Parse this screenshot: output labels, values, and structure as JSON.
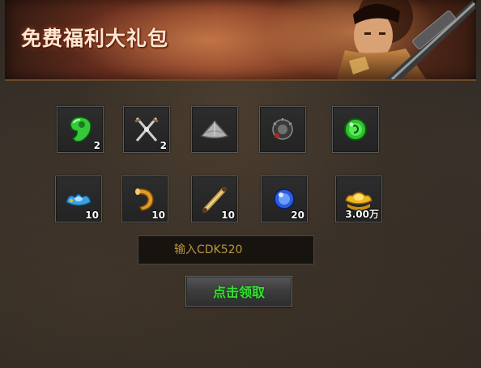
{
  "banner": {
    "title": "免费福利大礼包"
  },
  "rewards": {
    "row1": [
      {
        "icon": "green-jade-icon",
        "count": "2"
      },
      {
        "icon": "crossed-swords-icon",
        "count": "2"
      },
      {
        "icon": "bamboo-hat-icon",
        "count": ""
      },
      {
        "icon": "dark-orb-icon",
        "count": ""
      },
      {
        "icon": "green-gem-icon",
        "count": ""
      }
    ],
    "row2": [
      {
        "icon": "blue-ingot-icon",
        "count": "10"
      },
      {
        "icon": "horn-icon",
        "count": "10"
      },
      {
        "icon": "scroll-icon",
        "count": "10"
      },
      {
        "icon": "blue-pearl-icon",
        "count": "20"
      },
      {
        "icon": "gold-ingot-icon",
        "count": "3.00万"
      }
    ]
  },
  "cdk": {
    "placeholder": "输入CDK520"
  },
  "claim": {
    "label": "点击领取"
  },
  "colors": {
    "claim_text": "#33e233",
    "placeholder_text": "#b9963e",
    "slot_border": "#5a5a5a"
  }
}
